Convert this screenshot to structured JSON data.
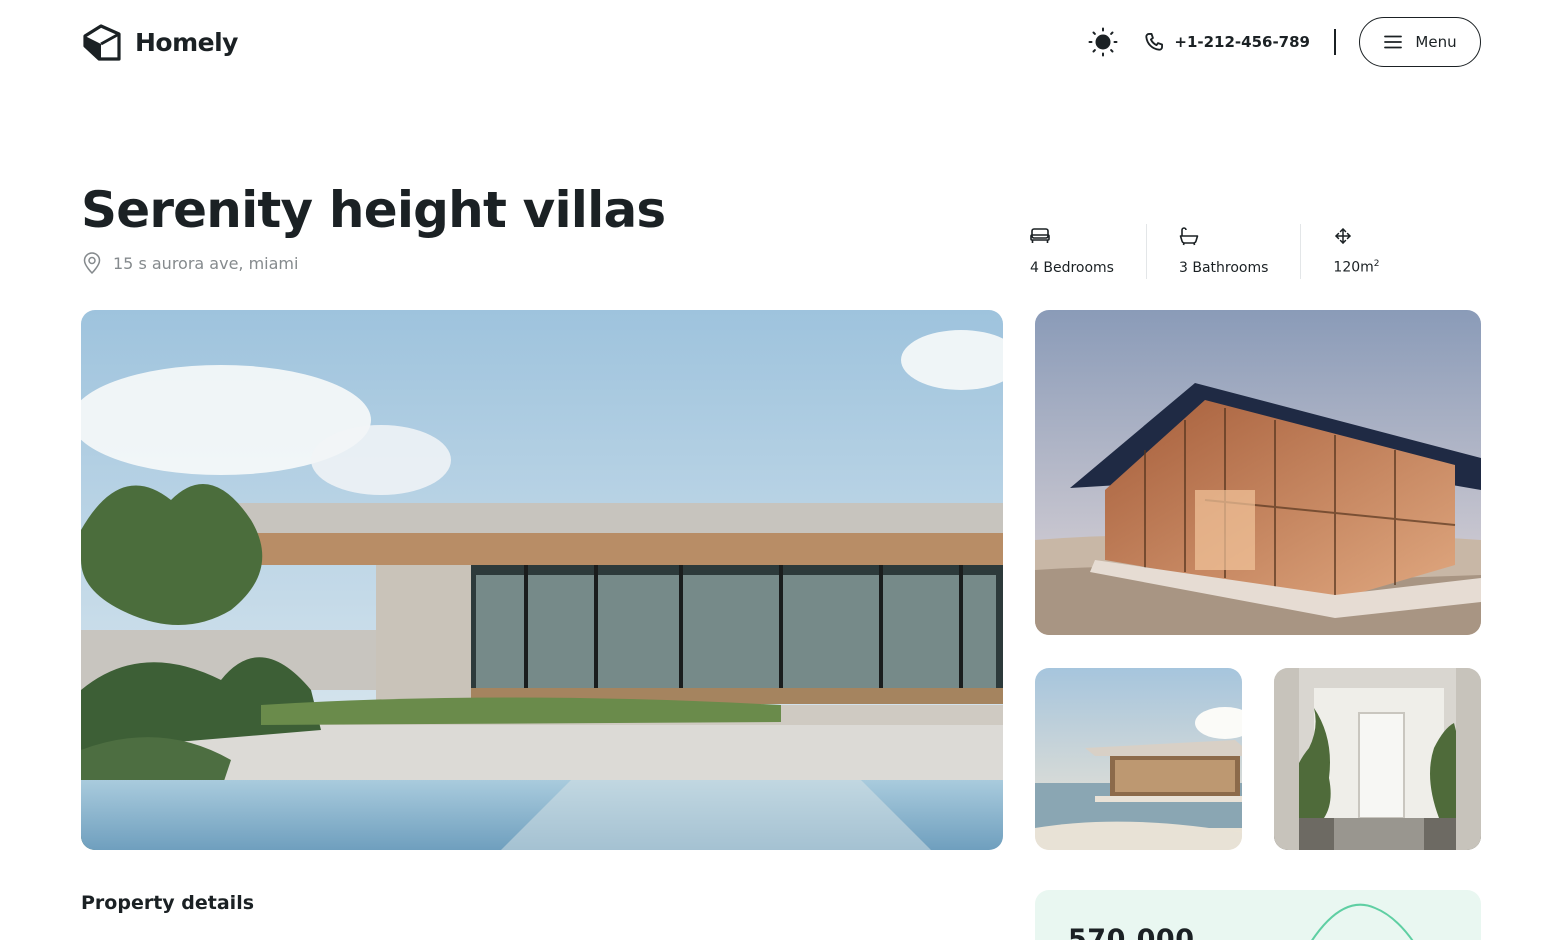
{
  "brand": {
    "name": "Homely",
    "icon": "house-logo-icon"
  },
  "header": {
    "theme_icon": "sun-icon",
    "phone_icon": "phone-icon",
    "phone": "+1-212-456-789",
    "menu_label": "Menu",
    "menu_icon": "hamburger-icon"
  },
  "property": {
    "title": "Serenity height villas",
    "address": "15 s aurora ave, miami",
    "stats": [
      {
        "icon": "bed-icon",
        "label": "4 Bedrooms"
      },
      {
        "icon": "bathtub-icon",
        "label": "3 Bathrooms"
      },
      {
        "icon": "move-arrows-icon",
        "value": "120m",
        "sup": "2"
      }
    ]
  },
  "gallery": [
    {
      "icon": "villa-pool-photo"
    },
    {
      "icon": "glass-house-desert-photo"
    },
    {
      "icon": "beach-house-photo"
    },
    {
      "icon": "entrance-plants-photo"
    }
  ],
  "details": {
    "section_title": "Property details"
  },
  "price": {
    "value": "570,000"
  },
  "colors": {
    "text": "#1b2124",
    "muted": "#858a8d",
    "price_card_bg": "#e9f7f1",
    "accent": "#5fcfa3"
  }
}
